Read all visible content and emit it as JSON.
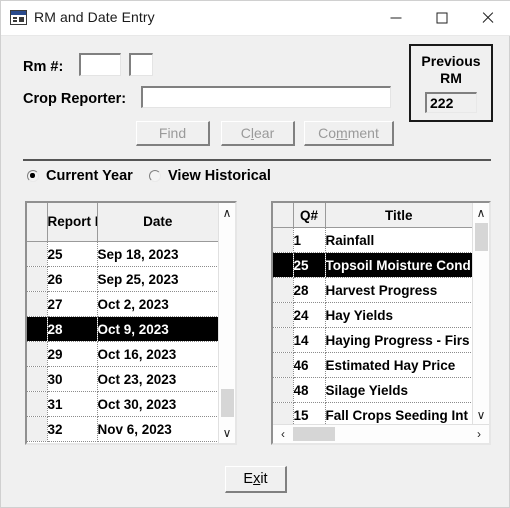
{
  "window": {
    "title": "RM and Date Entry",
    "icon": "form-table-icon",
    "controls": {
      "minimize": "minimize-icon",
      "maximize": "maximize-icon",
      "close": "close-icon"
    }
  },
  "form": {
    "rm_label": "Rm #:",
    "rm_value_1": "",
    "rm_value_2": "",
    "reporter_label": "Crop Reporter:",
    "reporter_value": "",
    "previous_rm": {
      "title_line_1": "Previous",
      "title_line_2": "RM",
      "value": "222"
    }
  },
  "buttons": {
    "find": {
      "before": "F",
      "accel": "",
      "after": "ind",
      "label": "Find",
      "enabled": false
    },
    "clear": {
      "before": "C",
      "accel": "l",
      "after": "ear",
      "label": "Clear",
      "enabled": false
    },
    "comment": {
      "before": "Co",
      "accel": "m",
      "after": "ment",
      "label": "Comment",
      "enabled": false
    },
    "exit": {
      "before": "E",
      "accel": "x",
      "after": "it",
      "label": "Exit",
      "enabled": true
    }
  },
  "view_mode": {
    "options": [
      {
        "label": "Current Year",
        "selected": true
      },
      {
        "label": "View Historical",
        "selected": false
      }
    ]
  },
  "reports_grid": {
    "headers": {
      "selector": "",
      "number": "Report Number",
      "date": "Date"
    },
    "rows": [
      {
        "number": "25",
        "date": "Sep 18, 2023",
        "selected": false
      },
      {
        "number": "26",
        "date": "Sep 25, 2023",
        "selected": false
      },
      {
        "number": "27",
        "date": "Oct 2, 2023",
        "selected": false
      },
      {
        "number": "28",
        "date": "Oct 9, 2023",
        "selected": true
      },
      {
        "number": "29",
        "date": "Oct 16, 2023",
        "selected": false
      },
      {
        "number": "30",
        "date": "Oct 23, 2023",
        "selected": false
      },
      {
        "number": "31",
        "date": "Oct 30, 2023",
        "selected": false
      },
      {
        "number": "32",
        "date": "Nov 6, 2023",
        "selected": false
      }
    ],
    "scrollbar": {
      "up": "∧",
      "down": "∨"
    }
  },
  "questions_grid": {
    "headers": {
      "selector": "",
      "qnum": "Q#",
      "title": "Title"
    },
    "rows": [
      {
        "qnum": "1",
        "title": "Rainfall",
        "selected": false
      },
      {
        "qnum": "25",
        "title": "Topsoil Moisture Cond",
        "selected": true
      },
      {
        "qnum": "28",
        "title": "Harvest Progress",
        "selected": false
      },
      {
        "qnum": "24",
        "title": "Hay Yields",
        "selected": false
      },
      {
        "qnum": "14",
        "title": "Haying Progress - Firs",
        "selected": false
      },
      {
        "qnum": "46",
        "title": "Estimated Hay Price",
        "selected": false
      },
      {
        "qnum": "48",
        "title": "Silage Yields",
        "selected": false
      },
      {
        "qnum": "15",
        "title": "Fall Crops Seeding Int",
        "selected": false
      }
    ],
    "scrollbar": {
      "up": "∧",
      "down": "∨",
      "left": "‹",
      "right": "›"
    }
  },
  "colors": {
    "window_bg": "#f0f0f0",
    "titlebar_bg": "#ffffff",
    "selection_bg": "#000000",
    "selection_fg": "#ffffff",
    "header_bg": "#f0f0f0",
    "icon_accent": "#2a4b8d"
  }
}
